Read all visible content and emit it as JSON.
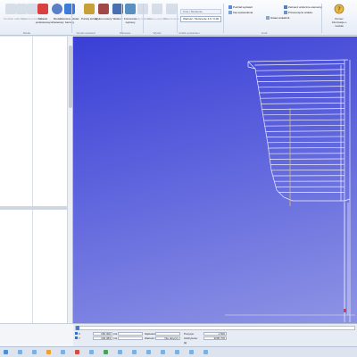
{
  "ribbon": {
    "buttons": [
      {
        "label": "Rozkład osi",
        "icon": "ruler-icon",
        "dim": true
      },
      {
        "label": "Uchwyt",
        "icon": "pin-icon",
        "dim": true
      },
      {
        "label": "Zmiana przekroju",
        "icon": "section-icon",
        "dim": true
      },
      {
        "label": "Szkielet podstawowy",
        "icon": "pencil-icon",
        "dim": false
      },
      {
        "label": "Model szkieletowy",
        "icon": "circle-icon",
        "dim": false
      },
      {
        "label": "Zarówno Model bazowy",
        "icon": "cube-icon",
        "dim": false
      },
      {
        "label": "Punkty kolory",
        "icon": "palette-icon",
        "dim": false
      },
      {
        "label": "Wykres kolory",
        "icon": "flag-icon",
        "dim": false
      },
      {
        "label": "Wektory",
        "icon": "vector-icon",
        "dim": false
      },
      {
        "label": "Konturowe wykresy",
        "icon": "contour-icon",
        "dim": false
      },
      {
        "label": "Wezły tekstowe",
        "icon": "node-icon",
        "dim": true
      },
      {
        "label": "Więcej opcji linii",
        "icon": "line-icon",
        "dim": true
      },
      {
        "label": "Zakończenia",
        "icon": "end-icon",
        "dim": true
      }
    ],
    "groups": [
      {
        "label": "Model"
      },
      {
        "label": "Wyniki wyświetl"
      },
      {
        "label": "Tekstowe"
      },
      {
        "label": "Wyniki"
      },
      {
        "label": "Grafik wyświetlen"
      },
      {
        "label": "Grafi"
      }
    ],
    "dropdown_header": "Krok | Śledzenie",
    "dropdown_value": "Wartość / Skrócenie 2.0 / 0.00",
    "right_items": [
      {
        "label": "Podział wyświetl",
        "icon": "split-icon"
      },
      {
        "label": "Kąt wyświetlenia",
        "icon": "angle-icon"
      },
      {
        "label": "Ustaw wskaźnik",
        "icon": "pointer-icon"
      },
      {
        "label": "Zaznacz widoczne elementy",
        "icon": "visible-icon"
      },
      {
        "label": "Przesunięcie widoku",
        "icon": "pan-icon"
      }
    ],
    "help_label": "Pomoc",
    "help_sub": "Informacje o module"
  },
  "bottom": {
    "row1": {
      "label": "X",
      "value1": "150.300",
      "unit1": "[m]",
      "label2": "Głębokość:",
      "value2": "",
      "label3": "Pozycja:",
      "value3": "1.500"
    },
    "row2": {
      "label": "Y",
      "value1": "106.383",
      "unit1": "[m]",
      "label2": "Wartość:",
      "value2": "Nie dotyczy",
      "label3": "Odchylenie:",
      "value3": "3005.700"
    },
    "row3": {
      "label": "",
      "value1": "",
      "unit1": "",
      "label2": "",
      "value2": "",
      "label3": "[k]",
      "value3": ""
    }
  },
  "colors": {
    "viewport_top": "#3a3fd6",
    "viewport_bottom": "#8e94e4",
    "model_lines": "#f0f0f8",
    "accent_line": "#d8c060"
  }
}
